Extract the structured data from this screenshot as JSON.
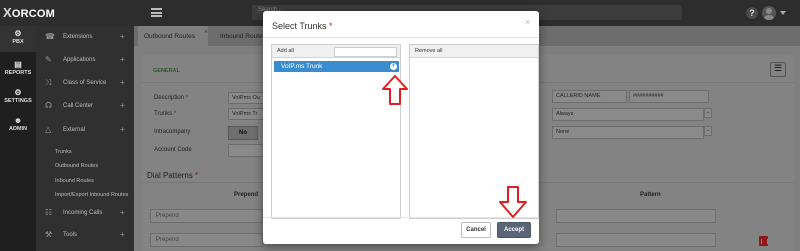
{
  "topbar": {
    "logo": "ORCOM",
    "logo_mark": "X",
    "search_placeholder": "Search...",
    "help_icon": "?"
  },
  "leftnav": {
    "items": [
      {
        "label": "PBX",
        "icon": "gear-icon",
        "glyph": "⚙",
        "active": true
      },
      {
        "label": "REPORTS",
        "icon": "document-icon",
        "glyph": "▤"
      },
      {
        "label": "SETTINGS",
        "icon": "cogs-icon",
        "glyph": "⚙"
      },
      {
        "label": "ADMIN",
        "icon": "users-icon",
        "glyph": "☻"
      }
    ]
  },
  "sidemenu": {
    "rows": [
      {
        "label": "Extensions",
        "icon": "phone-book-icon",
        "glyph": "☎"
      },
      {
        "label": "Applications",
        "icon": "edit-icon",
        "glyph": "✎"
      },
      {
        "label": "Class of Service",
        "icon": "shuffle-icon",
        "glyph": "⤨"
      },
      {
        "label": "Call Center",
        "icon": "headset-icon",
        "glyph": "☊"
      },
      {
        "label": "External",
        "icon": "road-icon",
        "glyph": "△"
      }
    ],
    "external_submenu": [
      "Trunks",
      "Outbound Routes",
      "Inbound Routes",
      "Import/Export Inbound Routes"
    ],
    "bottom_rows": [
      {
        "label": "Incoming Calls",
        "icon": "sitemap-icon",
        "glyph": "☷"
      },
      {
        "label": "Tools",
        "icon": "wrench-icon",
        "glyph": "⚒"
      }
    ],
    "plus": "+"
  },
  "main": {
    "tabs": [
      "Outbound Routes",
      "Inbound Routes"
    ],
    "tab_close": "×",
    "general_tab": "GENERAL",
    "form": {
      "description_label": "Description",
      "description_value": "VoIPms Ou",
      "trunks_label": "Trunks",
      "trunks_value": "VoIPms Tr",
      "intracompany_label": "Intracompany",
      "intracompany_value": "No",
      "account_code_label": "Account Code",
      "callerid_name_label": "CALLERID NAME",
      "callerid_name_value": "##########",
      "always_value": "Always",
      "none_value": "None"
    },
    "dial_patterns_title": "Dial Patterns",
    "columns": {
      "prepend": "Prepend",
      "pattern": "Pattern"
    },
    "prepend_placeholder": "Prepend",
    "required_mark": "*"
  },
  "modal": {
    "title": "Select Trunks",
    "required_mark": "*",
    "close": "×",
    "left_panel": {
      "header": "Add all",
      "items": [
        "VoIP.ms Trunk"
      ],
      "add_glyph": "+"
    },
    "right_panel": {
      "header": "Remove all"
    },
    "cancel_label": "Cancel",
    "accept_label": "Accept"
  },
  "colors": {
    "accent": "#3a8ccf",
    "accept_button": "#5a6677",
    "annotation_arrow": "#e02020"
  }
}
